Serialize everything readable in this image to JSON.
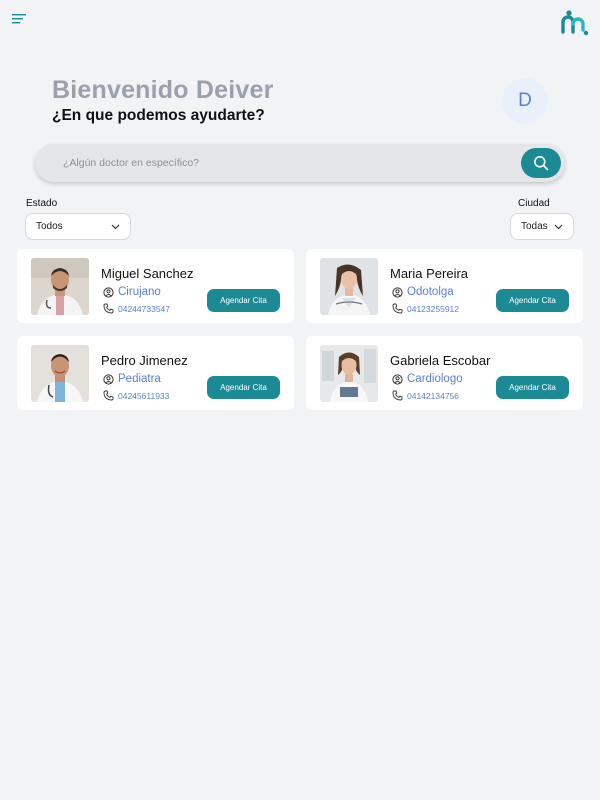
{
  "header": {
    "menu_icon": "hamburger-menu-icon",
    "logo_icon": "app-logo-icon",
    "welcome_title": "Bienvenido Deiver",
    "welcome_subtitle": "¿En que podemos ayudarte?",
    "avatar_initial": "D"
  },
  "search": {
    "placeholder": "¿Algún doctor en específico?",
    "icon": "search-icon"
  },
  "filters": {
    "estado_label": "Estado",
    "estado_value": "Todos",
    "ciudad_label": "Ciudad",
    "ciudad_value": "Todas"
  },
  "doctors": [
    {
      "name": "Miguel Sanchez",
      "specialty": "Cirujano",
      "phone": "04244733547",
      "button": "Agendar Cita"
    },
    {
      "name": "Maria Pereira",
      "specialty": "Odotolga",
      "phone": "04123255912",
      "button": "Agendar Cita"
    },
    {
      "name": "Pedro Jimenez",
      "specialty": "Pediatra",
      "phone": "04245611933",
      "button": "Agendar Cita"
    },
    {
      "name": "Gabriela Escobar",
      "specialty": "Cardiologo",
      "phone": "04142134756",
      "button": "Agendar Cita"
    }
  ],
  "colors": {
    "accent": "#1b8a95",
    "link": "#5b7fd6",
    "title_gray": "#9aa1ac",
    "background": "#f2f3f5"
  }
}
